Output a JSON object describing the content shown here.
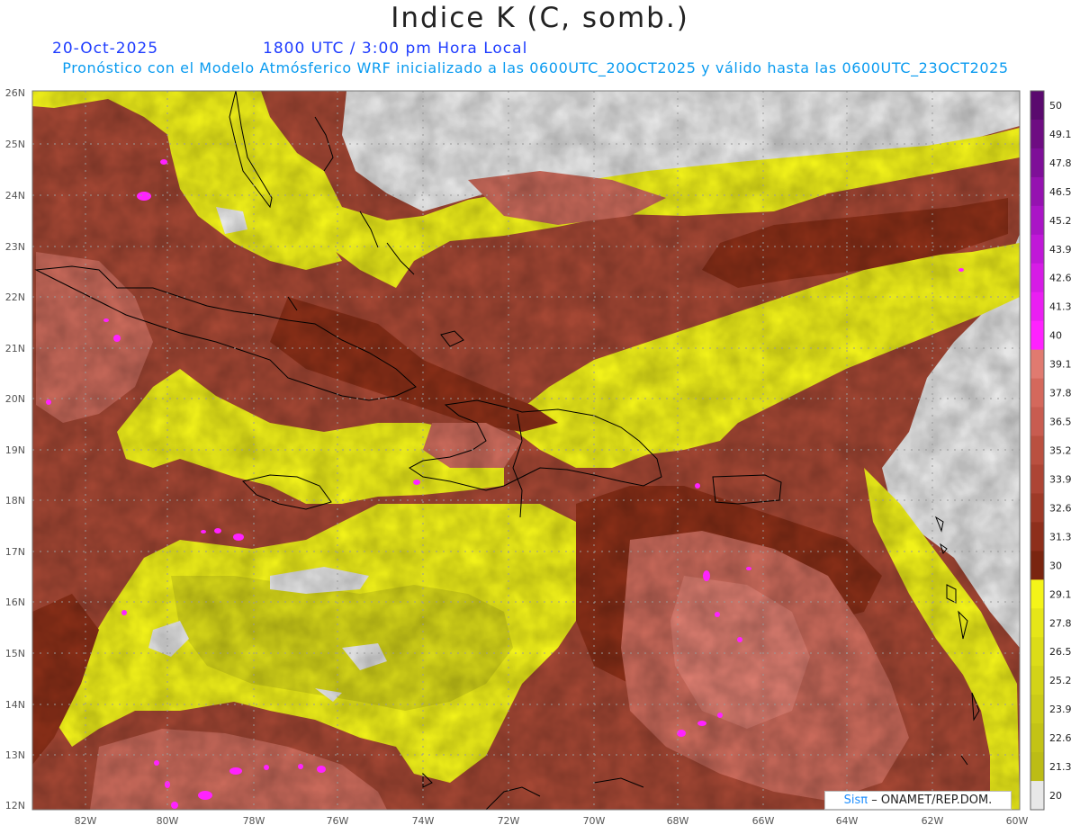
{
  "header": {
    "title": "Indice K (C, somb.)",
    "date": "20-Oct-2025",
    "time": "1800 UTC / 3:00 pm Hora Local",
    "subtitle": "Pronóstico con el Modelo Atmósferico WRF inicializado a las 0600UTC_20OCT2025 y válido hasta las  0600UTC_23OCT2025"
  },
  "map": {
    "lat_labels": [
      "26N",
      "25N",
      "24N",
      "23N",
      "22N",
      "21N",
      "20N",
      "19N",
      "18N",
      "17N",
      "16N",
      "15N",
      "14N",
      "13N",
      "12N"
    ],
    "lon_labels": [
      "82W",
      "80W",
      "78W",
      "76W",
      "74W",
      "72W",
      "70W",
      "68W",
      "66W",
      "64W",
      "62W",
      "60W"
    ],
    "colors": {
      "no_data": "#e6e6e6",
      "low_yellow": "#d6d619",
      "yellow": "#f1f11a",
      "brown_dark": "#8a2f18",
      "brown": "#a44734",
      "salmon": "#c8695a",
      "pink": "#d87b6e",
      "magenta": "#ff22ff",
      "coast": "#000000",
      "grid": "#9a9a9a"
    }
  },
  "colorbar": {
    "labels": [
      "50",
      "49.1",
      "47.8",
      "46.5",
      "45.2",
      "43.9",
      "42.6",
      "41.3",
      "40",
      "39.1",
      "37.8",
      "36.5",
      "35.2",
      "33.9",
      "32.6",
      "31.3",
      "30",
      "29.1",
      "27.8",
      "26.5",
      "25.2",
      "23.9",
      "22.6",
      "21.3",
      "20"
    ],
    "colors": [
      "#5a0a6e",
      "#6e0d82",
      "#7e0f98",
      "#9512b0",
      "#aa15c6",
      "#c018d8",
      "#d61ce6",
      "#ea1ff2",
      "#ff22ff",
      "#e07a70",
      "#d4685c",
      "#c85c50",
      "#ba5040",
      "#ad4535",
      "#9e3a28",
      "#8e2f1c",
      "#7a2510",
      "#f4f419",
      "#e6e619",
      "#dcdc18",
      "#d3d317",
      "#cbcb17",
      "#c3c316",
      "#bcbc16",
      "#e8e8e8"
    ]
  },
  "credit": {
    "brand": "Sisπ",
    "text": "– ONAMET/REP.DOM."
  }
}
